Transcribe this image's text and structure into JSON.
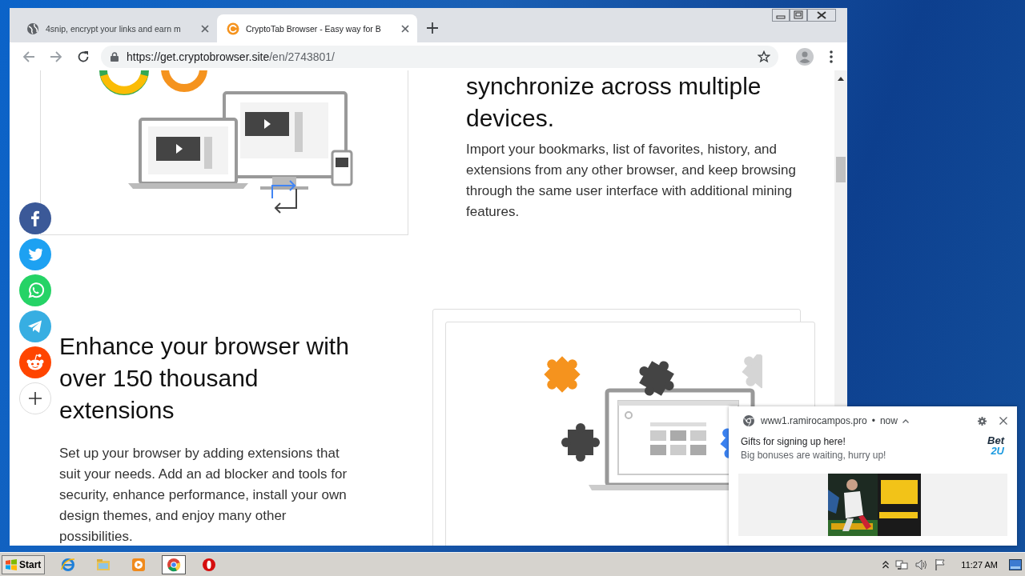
{
  "browser": {
    "tabs": [
      {
        "kind": "globe",
        "title": "4snip, encrypt your links and earn m",
        "selected": false
      },
      {
        "kind": "cryptotab",
        "title": "CryptoTab Browser - Easy way for B",
        "selected": true
      }
    ],
    "url": {
      "host": "https://get.cryptobrowser.site",
      "path": "/en/2743801/"
    }
  },
  "page": {
    "sync_section": {
      "heading": "synchronize across multiple devices.",
      "text": "Import your bookmarks, list of favorites, history, and extensions from any other browser, and keep browsing through the same user interface with additional mining features."
    },
    "extensions_section": {
      "heading": "Enhance your browser with over 150 thousand extensions",
      "text": "Set up your browser by adding extensions that suit your needs. Add an ad blocker and tools for security, enhance performance, install your own design themes, and enjoy many other possibilities."
    },
    "share_buttons": [
      {
        "kind": "facebook"
      },
      {
        "kind": "twitter"
      },
      {
        "kind": "whatsapp"
      },
      {
        "kind": "telegram"
      },
      {
        "kind": "reddit"
      },
      {
        "kind": "more"
      }
    ]
  },
  "notification": {
    "site": "www1.ramirocampos.pro",
    "separator": "•",
    "time": "now",
    "title": "Gifts for signing up here!",
    "body": "Big bonuses are waiting, hurry up!",
    "logo_lines": [
      "Bet",
      "2U"
    ]
  },
  "taskbar": {
    "start": "Start",
    "apps": [
      {
        "kind": "ie",
        "selected": false
      },
      {
        "kind": "folder",
        "selected": false
      },
      {
        "kind": "media",
        "selected": false
      },
      {
        "kind": "chrome",
        "selected": true
      },
      {
        "kind": "opera",
        "selected": false
      }
    ],
    "clock": "11:27 AM"
  }
}
